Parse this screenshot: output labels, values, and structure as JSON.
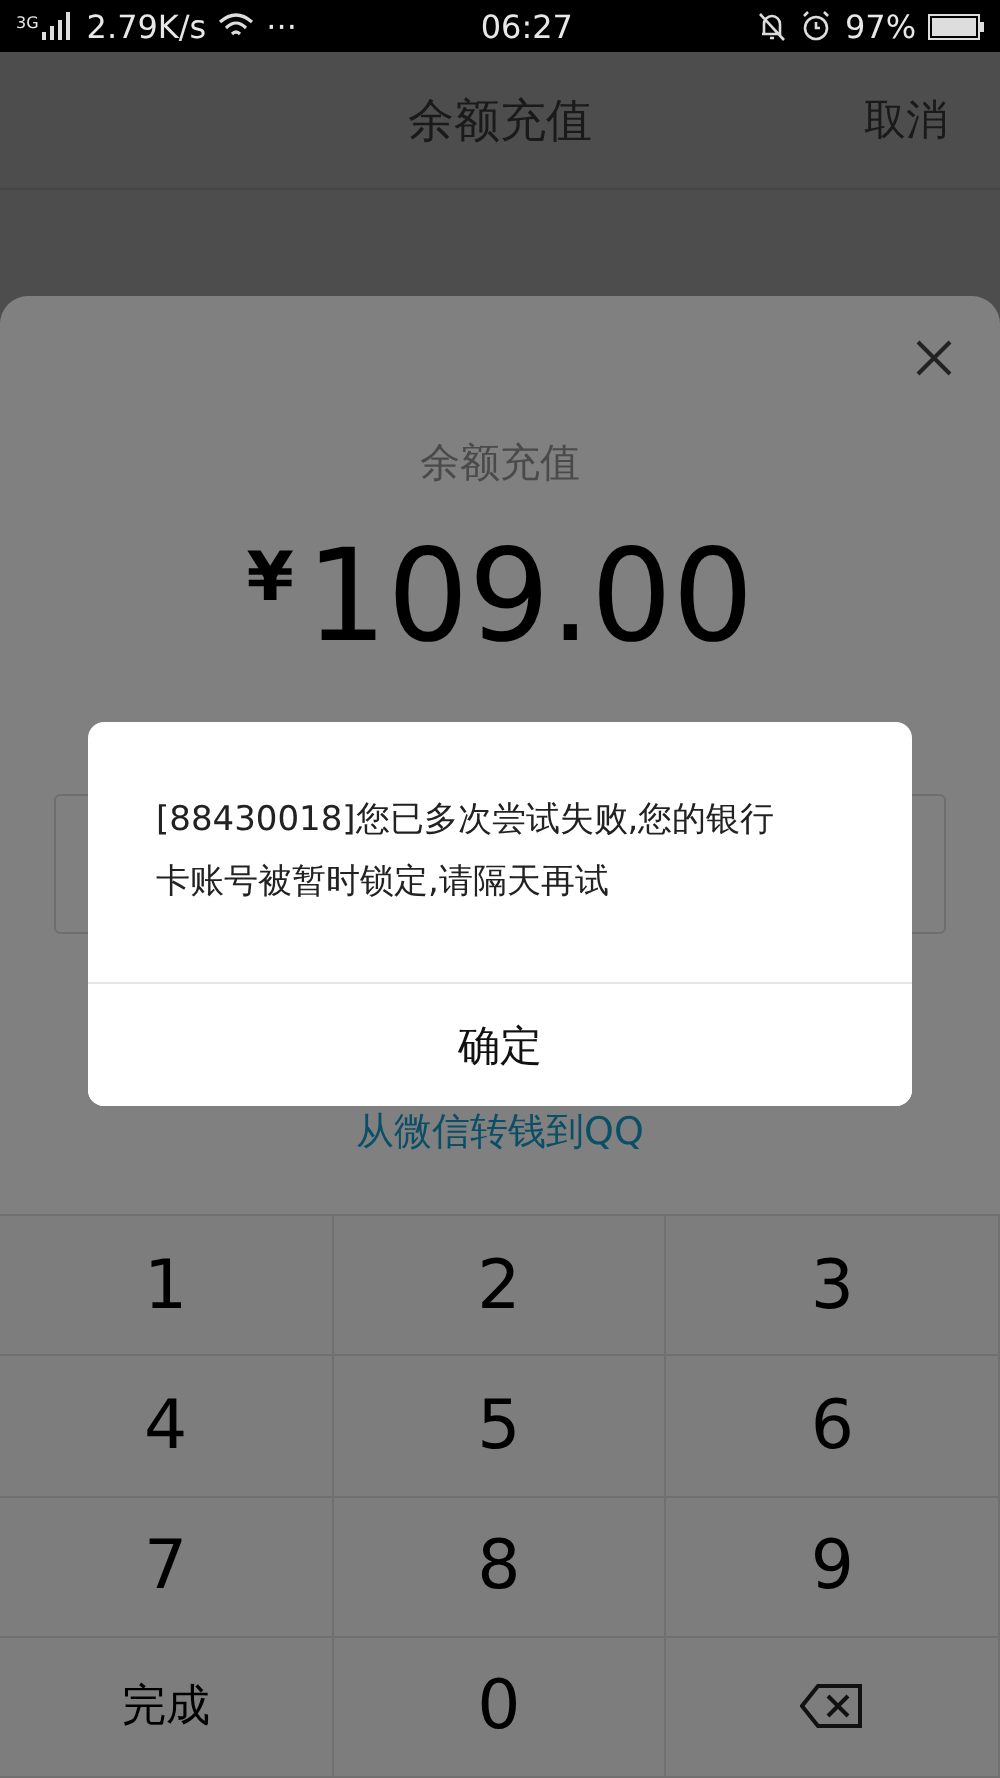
{
  "status_bar": {
    "network_type": "3G",
    "speed": "2.79K/s",
    "more": "···",
    "time": "06:27",
    "battery": "97%"
  },
  "header": {
    "title": "余额充值",
    "action": "取消"
  },
  "sheet": {
    "title": "余额充值",
    "currency": "¥",
    "amount": "109.00",
    "link": "从微信转钱到QQ"
  },
  "keypad": [
    {
      "kind": "digit",
      "label": "1"
    },
    {
      "kind": "digit",
      "label": "2"
    },
    {
      "kind": "digit",
      "label": "3"
    },
    {
      "kind": "digit",
      "label": "4"
    },
    {
      "kind": "digit",
      "label": "5"
    },
    {
      "kind": "digit",
      "label": "6"
    },
    {
      "kind": "digit",
      "label": "7"
    },
    {
      "kind": "digit",
      "label": "8"
    },
    {
      "kind": "digit",
      "label": "9"
    },
    {
      "kind": "text",
      "label": "完成"
    },
    {
      "kind": "digit",
      "label": "0"
    },
    {
      "kind": "backspace"
    }
  ],
  "dialog": {
    "message": "[88430018]您已多次尝试失败,您的银行卡账号被暂时锁定,请隔天再试",
    "button": "确定"
  }
}
